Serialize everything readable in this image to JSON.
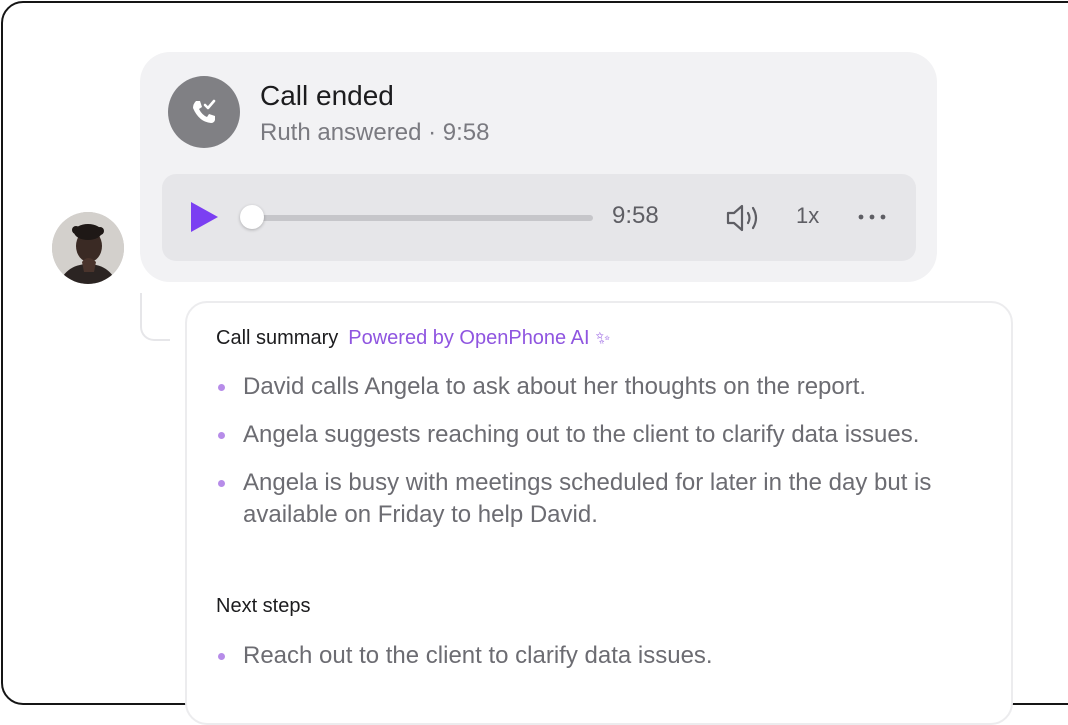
{
  "call": {
    "title": "Call ended",
    "subtitle": "Ruth answered · 9:58",
    "status_icon": "phone-check-icon",
    "icon_color": "#808084"
  },
  "player": {
    "time": "9:58",
    "speed": "1x",
    "progress": 0,
    "accent_color": "#7b3ff2"
  },
  "summary": {
    "title": "Call summary",
    "powered_by": "Powered by OpenPhone AI",
    "accent_color": "#8f55e0",
    "items": [
      "David calls Angela to ask about her thoughts on the report.",
      "Angela suggests reaching out to the client to clarify data issues.",
      "Angela is busy with meetings scheduled for later in the day but is available on Friday to help David."
    ],
    "next_steps_title": "Next steps",
    "next_steps": [
      "Reach out to the client to clarify data issues."
    ]
  }
}
